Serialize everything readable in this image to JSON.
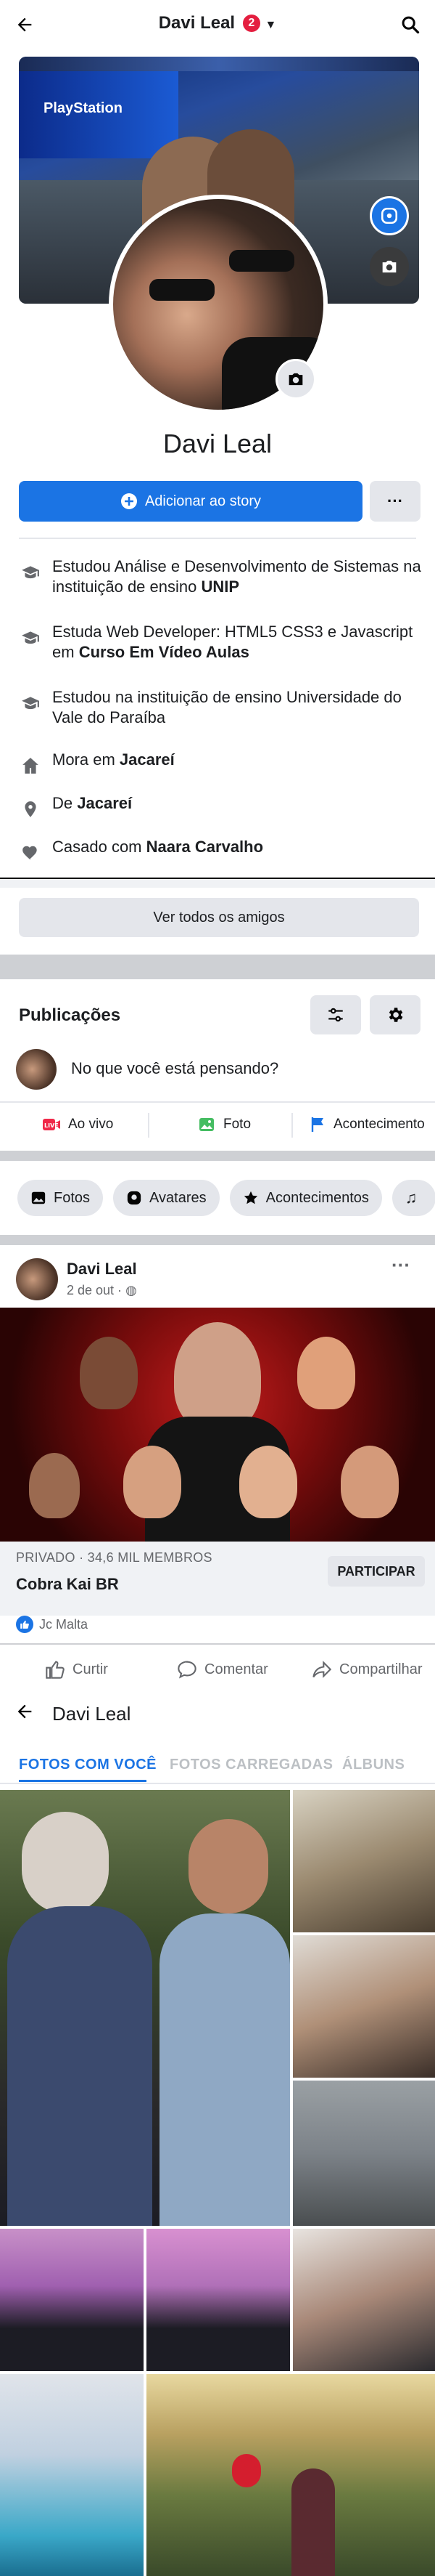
{
  "header": {
    "title": "Davi Leal",
    "badge": "2"
  },
  "cover": {
    "sign_text": "PlayStation"
  },
  "profile": {
    "name": "Davi Leal",
    "add_story_label": "Adicionar ao story",
    "more_label": "···"
  },
  "info": [
    {
      "icon": "graduation-cap-icon",
      "prefix": "Estudou Análise e Desenvolvimento de Sistemas na instituição de ensino ",
      "bold": "UNIP"
    },
    {
      "icon": "graduation-cap-icon",
      "prefix": "Estuda Web Developer: HTML5 CSS3 e Javascript em ",
      "bold": "Curso Em Vídeo Aulas"
    },
    {
      "icon": "graduation-cap-icon",
      "prefix": "Estudou na instituição de ensino Universidade do Vale do Paraíba",
      "bold": ""
    },
    {
      "icon": "home-icon",
      "prefix": "Mora em ",
      "bold": "Jacareí"
    },
    {
      "icon": "location-pin-icon",
      "prefix": "De ",
      "bold": "Jacareí"
    },
    {
      "icon": "heart-icon",
      "prefix": "Casado com ",
      "bold": "Naara Carvalho"
    }
  ],
  "friends": {
    "see_all_label": "Ver todos os amigos"
  },
  "publications": {
    "title": "Publicações",
    "composer_placeholder": "No que você está pensando?",
    "quick_actions": [
      "Ao vivo",
      "Foto",
      "Acontecimento"
    ],
    "chips": [
      "Fotos",
      "Avatares",
      "Acontecimentos"
    ]
  },
  "post": {
    "author": "Davi Leal",
    "date": "2 de out · ",
    "more": "···",
    "group_meta": "PRIVADO · 34,6 MIL MEMBROS",
    "group_name": "Cobra Kai BR",
    "join_label": "PARTICIPAR",
    "reactor": "Jc Malta",
    "actions": [
      "Curtir",
      "Comentar",
      "Compartilhar"
    ]
  },
  "photos": {
    "title": "Davi Leal",
    "tabs": [
      "FOTOS COM VOCÊ",
      "FOTOS CARREGADAS",
      "ÁLBUNS"
    ]
  },
  "colors": {
    "accent": "#1b74e4",
    "badge": "#e41e3f",
    "divider": "#ced0d4"
  }
}
